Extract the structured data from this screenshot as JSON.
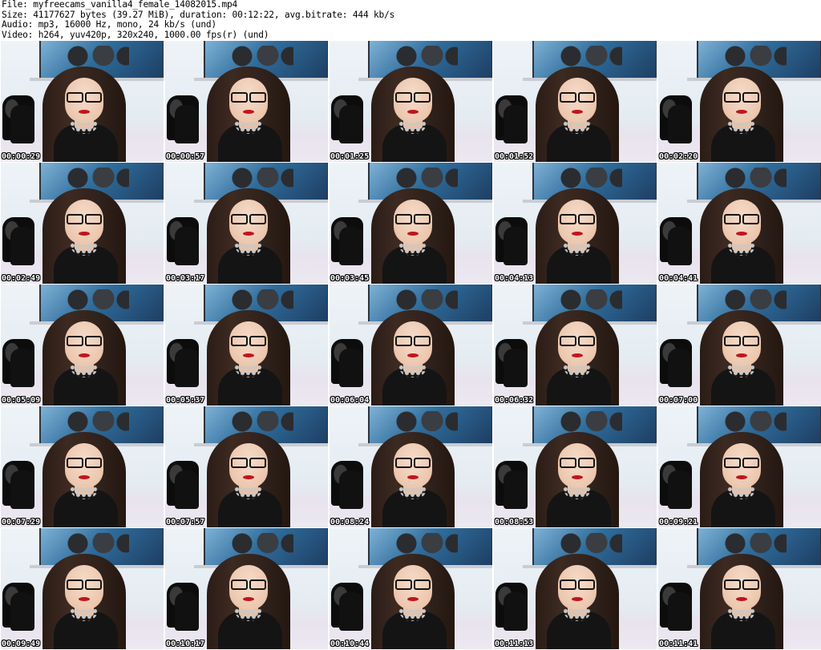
{
  "info": {
    "file_line": "File: myfreecams_vanilla4_female_14082015.mp4",
    "size_line": "Size: 41177627 bytes (39.27 MiB), duration: 00:12:22, avg.bitrate: 444 kb/s",
    "audio_line": "Audio: mp3, 16000 Hz, mono, 24 kb/s (und)",
    "video_line": "Video: h264, yuv420p, 320x240, 1000.00 fps(r) (und)"
  },
  "thumbnails": [
    {
      "timestamp": "00:00:29"
    },
    {
      "timestamp": "00:00:57"
    },
    {
      "timestamp": "00:01:25"
    },
    {
      "timestamp": "00:01:52"
    },
    {
      "timestamp": "00:02:20"
    },
    {
      "timestamp": "00:02:49"
    },
    {
      "timestamp": "00:03:17"
    },
    {
      "timestamp": "00:03:45"
    },
    {
      "timestamp": "00:04:13"
    },
    {
      "timestamp": "00:04:41"
    },
    {
      "timestamp": "00:05:09"
    },
    {
      "timestamp": "00:05:37"
    },
    {
      "timestamp": "00:06:04"
    },
    {
      "timestamp": "00:06:32"
    },
    {
      "timestamp": "00:07:00"
    },
    {
      "timestamp": "00:07:29"
    },
    {
      "timestamp": "00:07:57"
    },
    {
      "timestamp": "00:08:24"
    },
    {
      "timestamp": "00:08:53"
    },
    {
      "timestamp": "00:09:21"
    },
    {
      "timestamp": "00:09:49"
    },
    {
      "timestamp": "00:10:17"
    },
    {
      "timestamp": "00:10:44"
    },
    {
      "timestamp": "00:11:13"
    },
    {
      "timestamp": "00:11:41"
    }
  ]
}
